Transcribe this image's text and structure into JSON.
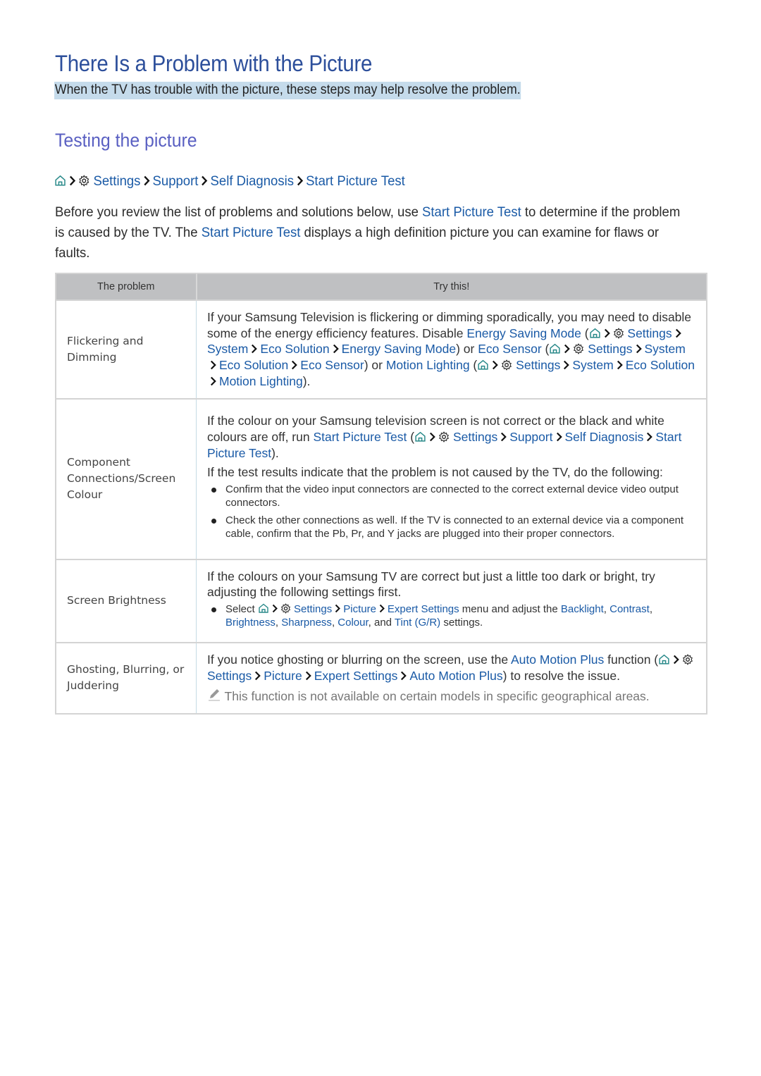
{
  "page": {
    "title": "There Is a Problem with the Picture",
    "subtitle": "When the TV has trouble with the picture, these steps may help resolve the problem.",
    "section_title": "Testing the picture"
  },
  "path": {
    "icons": [
      "home-icon",
      "chevron-right-icon",
      "gear-icon"
    ],
    "items": [
      "Settings",
      "Support",
      "Self Diagnosis",
      "Start Picture Test"
    ]
  },
  "intro": {
    "part1": "Before you review the list of problems and solutions below, use ",
    "link1": "Start Picture Test",
    "part2": " to determine if the problem is caused by the TV. The ",
    "link2": "Start Picture Test",
    "part3": " displays a high definition picture you can examine for flaws or faults."
  },
  "table": {
    "headers": [
      "The problem",
      "Try this!"
    ],
    "rows": [
      {
        "problem": "Flickering and Dimming",
        "t1": "If your Samsung Television is flickering or dimming sporadically, you may need to disable some of the energy efficiency features. Disable ",
        "l_esm": "Energy Saving Mode",
        "settings": "Settings",
        "system": "System",
        "eco_solution": "Eco Solution",
        "energy_saving_mode": "Energy Saving Mode",
        "or1": ") or ",
        "l_eco_sensor": "Eco Sensor",
        "eco_sensor": "Eco Sensor",
        "or2": ") or ",
        "l_motion": "Motion Lighting",
        "motion_lighting": "Motion Lighting",
        "end": ")."
      },
      {
        "problem": "Component Connections/Screen Colour",
        "t1": "If the colour on your Samsung television screen is not correct or the black and white colours are off, run ",
        "l_spt": "Start Picture Test",
        "settings": "Settings",
        "support": "Support",
        "self_diagnosis": "Self Diagnosis",
        "start_picture_test": "Start Picture Test",
        "end": ").",
        "t2": "If the test results indicate that the problem is not caused by the TV, do the following:",
        "bullets": [
          "Confirm that the video input connectors are connected to the correct external device video output connectors.",
          "Check the other connections as well. If the TV is connected to an external device via a component cable, confirm that the Pb, Pr, and Y jacks are plugged into their proper connectors."
        ]
      },
      {
        "problem": "Screen Brightness",
        "t1": "If the colours on your Samsung TV are correct but just a little too dark or bright, try adjusting the following settings first.",
        "select": "Select ",
        "settings": "Settings",
        "picture": "Picture",
        "expert_settings": "Expert Settings",
        "mid": " menu and adjust the ",
        "backlight": "Backlight",
        "contrast": "Contrast",
        "brightness": "Brightness",
        "sharpness": "Sharpness",
        "colour": "Colour",
        "and": ", and ",
        "tint": "Tint (G/R)",
        "end": " settings."
      },
      {
        "problem": "Ghosting, Blurring, or Juddering",
        "t1": "If you notice ghosting or blurring on the screen, use the ",
        "l_amp": "Auto Motion Plus",
        "t2": " function (",
        "settings": "Settings",
        "picture": "Picture",
        "expert_settings": "Expert Settings",
        "auto_motion_plus": "Auto Motion Plus",
        "end": ") to resolve the issue.",
        "note": "This function is not available on certain models in specific geographical areas."
      }
    ]
  },
  "colors": {
    "title": "#2d4f9b",
    "section": "#5a60c2",
    "link": "#1a5aa6",
    "highlight": "#c5dbeb",
    "table_header": "#bfc0c2"
  }
}
